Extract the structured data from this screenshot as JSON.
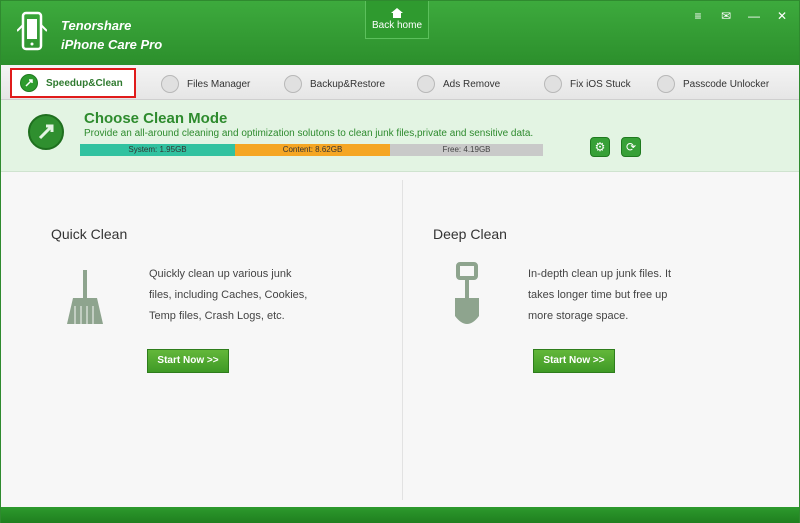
{
  "header": {
    "brand_line1": "Tenorshare",
    "brand_line2": "iPhone Care Pro",
    "back_home": "Back home"
  },
  "tabs": [
    {
      "label": "Speedup&Clean",
      "icon": "rocket-icon"
    },
    {
      "label": "Files Manager",
      "icon": "file-icon"
    },
    {
      "label": "Backup&Restore",
      "icon": "folder-icon"
    },
    {
      "label": "Ads Remove",
      "icon": "trash-icon"
    },
    {
      "label": "Fix iOS Stuck",
      "icon": "refresh-icon"
    },
    {
      "label": "Passcode Unlocker",
      "icon": "key-icon"
    }
  ],
  "mode": {
    "title": "Choose Clean Mode",
    "description": "Provide an all-around cleaning and optimization solutons to clean junk files,private and sensitive data.",
    "storage": {
      "system": "System: 1.95GB",
      "content": "Content: 8.62GB",
      "free": "Free: 4.19GB"
    }
  },
  "quick": {
    "title": "Quick Clean",
    "desc1": "Quickly clean up various junk",
    "desc2": "files, including Caches, Cookies,",
    "desc3": "Temp files, Crash Logs, etc.",
    "button": "Start Now >>"
  },
  "deep": {
    "title": "Deep Clean",
    "desc1": "In-depth clean up junk files. It",
    "desc2": "takes longer time but free up",
    "desc3": "more storage space.",
    "button": "Start Now >>"
  },
  "colors": {
    "header": "#2c8f2c",
    "system": "#31c2a0",
    "content": "#f5a623",
    "free": "#c9c9c9",
    "active_border": "#e01b1b"
  }
}
